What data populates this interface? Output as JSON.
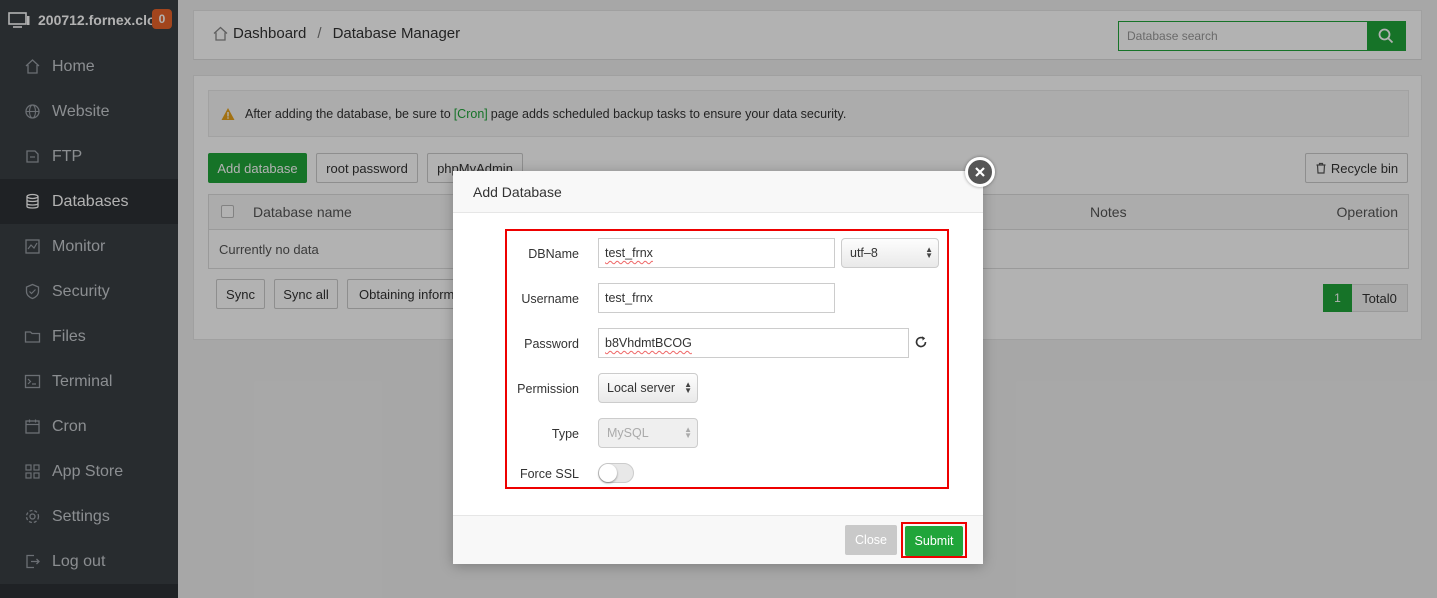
{
  "sidebar": {
    "server_name": "200712.fornex.clo",
    "badge": "0",
    "items": [
      {
        "label": "Home",
        "icon": "home-icon"
      },
      {
        "label": "Website",
        "icon": "globe-icon"
      },
      {
        "label": "FTP",
        "icon": "ftp-icon"
      },
      {
        "label": "Databases",
        "icon": "database-icon"
      },
      {
        "label": "Monitor",
        "icon": "monitor-icon"
      },
      {
        "label": "Security",
        "icon": "shield-icon"
      },
      {
        "label": "Files",
        "icon": "folder-icon"
      },
      {
        "label": "Terminal",
        "icon": "terminal-icon"
      },
      {
        "label": "Cron",
        "icon": "calendar-icon"
      },
      {
        "label": "App Store",
        "icon": "grid-icon"
      },
      {
        "label": "Settings",
        "icon": "gear-icon"
      },
      {
        "label": "Log out",
        "icon": "logout-icon"
      }
    ],
    "active": "Databases"
  },
  "header": {
    "breadcrumb": [
      "Dashboard",
      "Database Manager"
    ],
    "search_placeholder": "Database search"
  },
  "alert": {
    "text_before": "After adding the database, be sure to",
    "link": "[Cron]",
    "text_after": "page adds scheduled backup tasks to ensure your data security."
  },
  "toolbar": {
    "add_database": "Add database",
    "root_password": "root password",
    "phpmyadmin": "phpMyAdmin",
    "recycle_bin": "Recycle bin"
  },
  "table": {
    "columns": [
      "Database name",
      "Notes",
      "Operation"
    ],
    "empty_text": "Currently no data"
  },
  "bottom_actions": {
    "sync": "Sync",
    "sync_all": "Sync all",
    "obtaining": "Obtaining inform"
  },
  "pagination": {
    "current": "1",
    "total": "Total0"
  },
  "modal": {
    "title": "Add Database",
    "fields": {
      "dbname_label": "DBName",
      "dbname_value": "test_frnx",
      "charset_value": "utf–8",
      "username_label": "Username",
      "username_value": "test_frnx",
      "password_label": "Password",
      "password_value": "b8VhdmtBCOG",
      "permission_label": "Permission",
      "permission_value": "Local server",
      "type_label": "Type",
      "type_value": "MySQL",
      "force_ssl_label": "Force SSL",
      "force_ssl_on": false
    },
    "close_label": "Close",
    "submit_label": "Submit"
  },
  "colors": {
    "accent": "#20a53a",
    "sidebar_bg": "#3a3f44",
    "highlight": "#e00000",
    "badge": "#e8632a"
  }
}
